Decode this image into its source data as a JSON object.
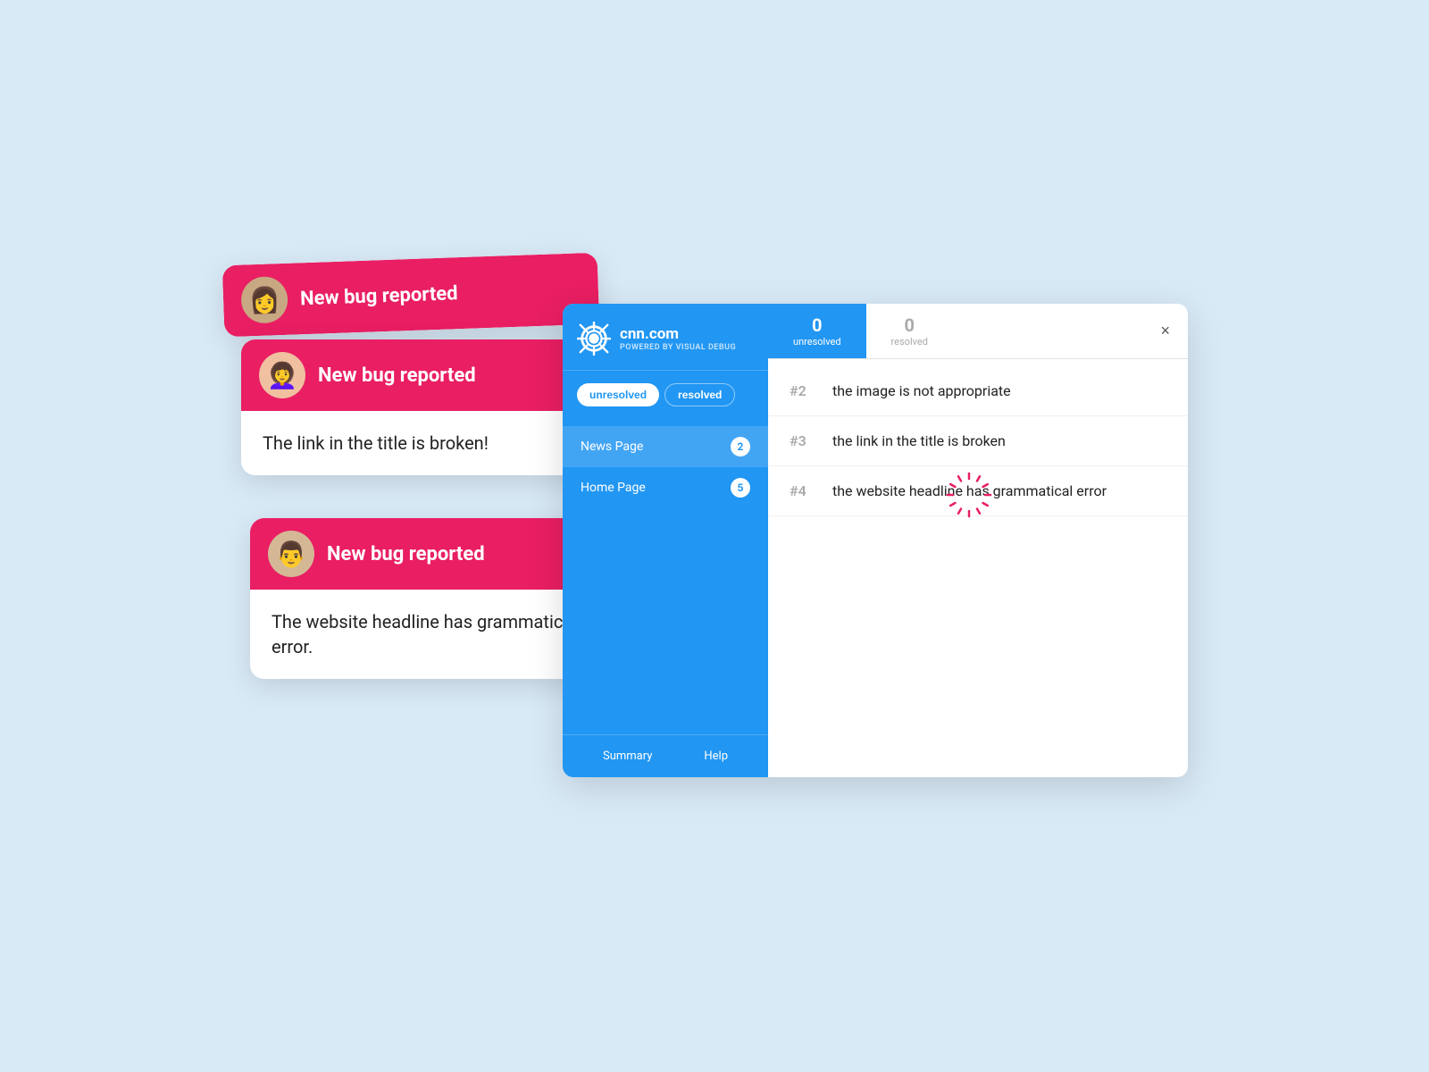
{
  "background_color": "#d9eaf7",
  "accent_color": "#e91e63",
  "brand_color": "#2196f3",
  "cards": [
    {
      "id": "card-1",
      "header": "New bug reported",
      "body": null,
      "avatar_emoji": "👩"
    },
    {
      "id": "card-2",
      "header": "New bug reported",
      "body": "The link in the title is broken!",
      "avatar_emoji": "👩‍🦱"
    },
    {
      "id": "card-3",
      "header": "New bug reported",
      "body": "The website headline has grammatical error.",
      "avatar_emoji": "👨"
    }
  ],
  "sidebar": {
    "domain": "cnn.com",
    "subtitle": "POWERED BY VISUAL DEBUG",
    "tab_unresolved": "unresolved",
    "tab_resolved": "resolved",
    "nav_items": [
      {
        "label": "News Page",
        "badge": "2"
      },
      {
        "label": "Home Page",
        "badge": "5"
      }
    ],
    "footer_links": [
      "Summary",
      "Help"
    ]
  },
  "content": {
    "tab_unresolved_count": "0",
    "tab_unresolved_label": "unresolved",
    "tab_resolved_count": "0",
    "tab_resolved_label": "resolved",
    "close_button": "×",
    "bugs": [
      {
        "number": "#2",
        "description": "the image is not appropriate"
      },
      {
        "number": "#3",
        "description": "the link in the title is broken"
      },
      {
        "number": "#4",
        "description": "the website headline has grammatical error"
      }
    ]
  }
}
